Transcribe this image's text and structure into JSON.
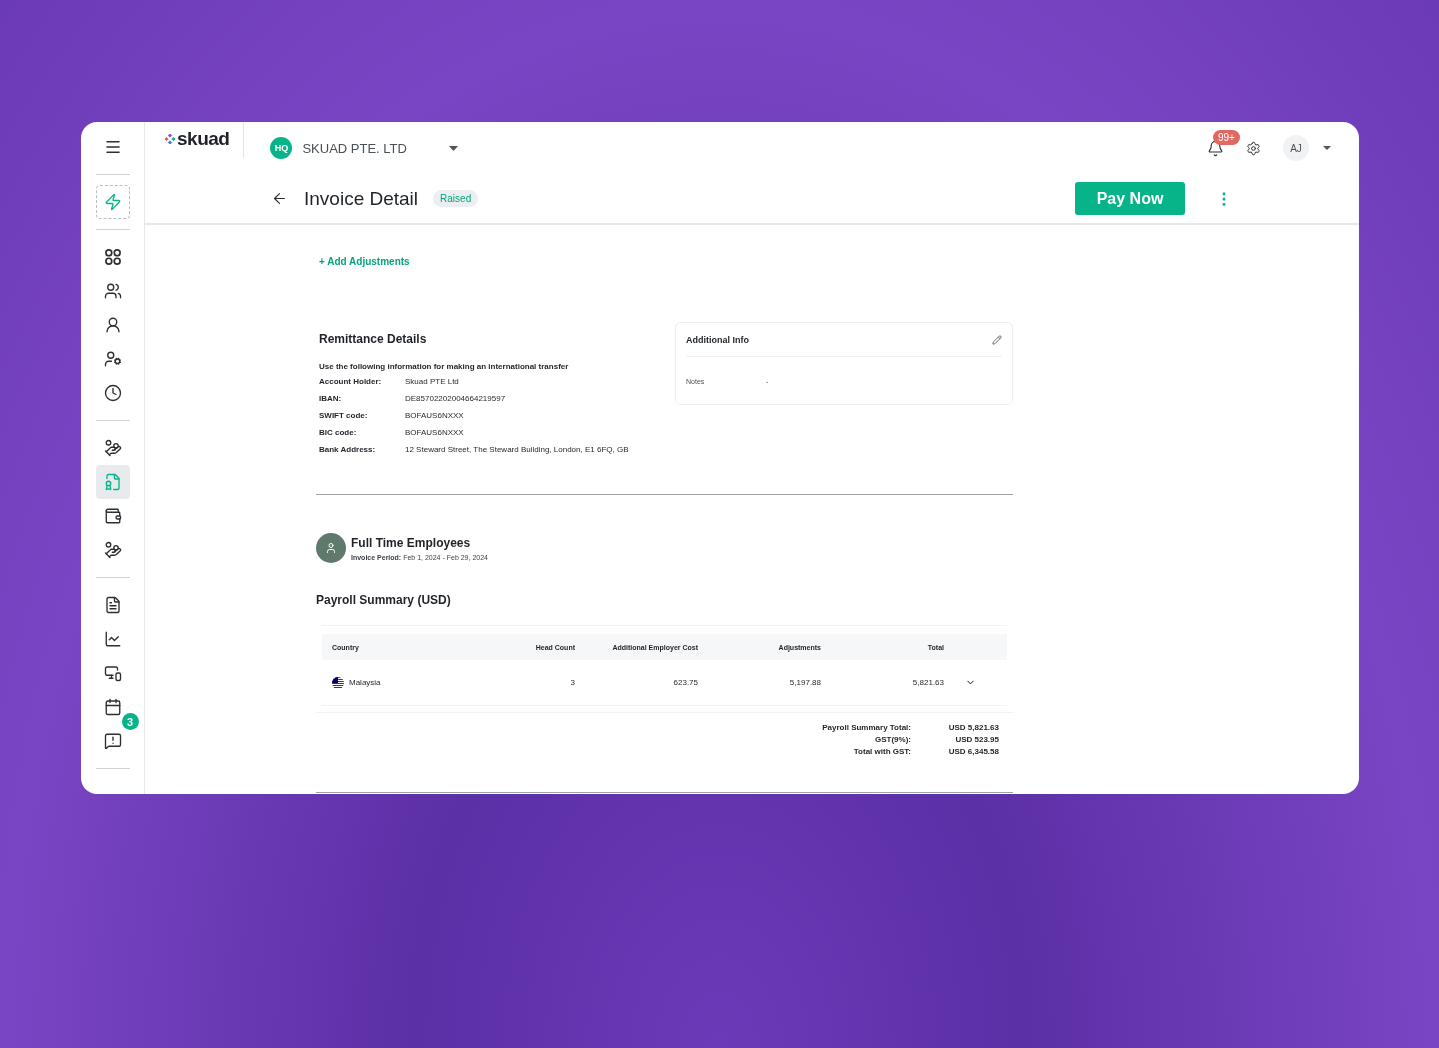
{
  "header": {
    "logo": "skuad",
    "company_badge": "HQ",
    "company": "SKUAD PTE. LTD",
    "notifications": "99+",
    "avatar": "AJ"
  },
  "title_bar": {
    "title": "Invoice Detail",
    "status": "Raised",
    "primary_action": "Pay Now"
  },
  "sidebar": {
    "groups": [
      [
        {
          "kind": "action",
          "selected": false
        }
      ],
      [
        {
          "kind": "nav",
          "selected": false
        },
        {
          "kind": "nav",
          "selected": false
        },
        {
          "kind": "nav",
          "selected": false
        },
        {
          "kind": "nav",
          "selected": false
        },
        {
          "kind": "nav",
          "selected": false
        }
      ],
      [
        {
          "kind": "nav",
          "selected": false
        },
        {
          "kind": "nav",
          "selected": true
        },
        {
          "kind": "nav",
          "selected": false
        },
        {
          "kind": "nav",
          "selected": false
        }
      ],
      [
        {
          "kind": "nav",
          "selected": false
        },
        {
          "kind": "nav",
          "selected": false
        },
        {
          "kind": "nav",
          "selected": false
        },
        {
          "kind": "nav",
          "selected": false
        },
        {
          "kind": "nav",
          "selected": false,
          "badge": "3"
        }
      ]
    ]
  },
  "add_adjustments": "+ Add Adjustments",
  "remittance": {
    "title": "Remittance Details",
    "intro": "Use the following information for making an international transfer",
    "rows": [
      {
        "label": "Account Holder:",
        "value": "Skuad PTE Ltd"
      },
      {
        "label": "IBAN:",
        "value": "DE85702202004664219597"
      },
      {
        "label": "SWIFT code:",
        "value": "BOFAUS6NXXX"
      },
      {
        "label": "BIC code:",
        "value": "BOFAUS6NXXX"
      },
      {
        "label": "Bank Address:",
        "value": "12 Steward Street, The Steward Building, London, E1 6FQ, GB"
      }
    ]
  },
  "additional_info": {
    "title": "Additional Info",
    "rows": [
      {
        "label": "Notes",
        "value": "-"
      }
    ]
  },
  "employee_group": {
    "title": "Full Time Employees",
    "period_label": "Invoice Period:",
    "period": "Feb 1, 2024 - Feb 29, 2024"
  },
  "payroll": {
    "title": "Payroll Summary (USD)",
    "columns": [
      "Country",
      "Head Count",
      "Additional Employer Cost",
      "Adjustments",
      "Total"
    ],
    "rows": [
      {
        "country": "Malaysia",
        "head_count": "3",
        "employer_cost": "623.75",
        "adjustments": "5,197.88",
        "total": "5,821.63",
        "expanded": false
      }
    ],
    "totals": [
      {
        "label": "Payroll Summary Total:",
        "value": "USD 5,821.63"
      },
      {
        "label": "GST(9%):",
        "value": "USD 523.95"
      },
      {
        "label": "Total with GST:",
        "value": "USD 6,345.58"
      }
    ]
  }
}
